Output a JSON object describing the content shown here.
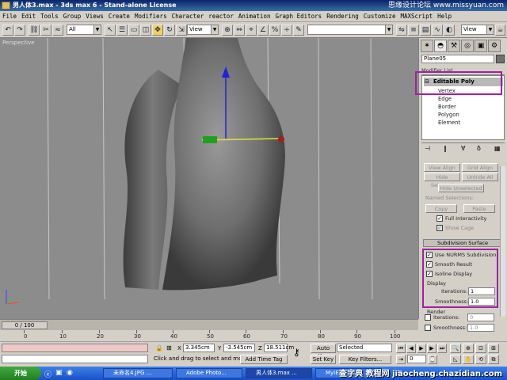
{
  "window": {
    "title": "男人体3.max - 3ds max 6 - Stand-alone License"
  },
  "watermark_top": "思缘设计论坛 www.missyuan.com",
  "menu": [
    "File",
    "Edit",
    "Tools",
    "Group",
    "Views",
    "Create",
    "Modifiers",
    "Character",
    "reactor",
    "Animation",
    "Graph Editors",
    "Rendering",
    "Customize",
    "MAXScript",
    "Help"
  ],
  "toolbar": {
    "selection_filter": "All",
    "ref_coord": "View",
    "named_sel": "",
    "view_dropdown": "View"
  },
  "viewport": {
    "label": "Perspective"
  },
  "panel": {
    "object_name": "Plane05",
    "modifier_list": "Modifier List",
    "stack_top": "Editable Poly",
    "stack_items": [
      "Vertex",
      "Edge",
      "Border",
      "Polygon",
      "Element"
    ],
    "buttons": {
      "view_align": "View Align",
      "grid_align": "Grid Align",
      "hide_selected": "Hide Selected",
      "unhide_all": "Unhide All",
      "hide_unselected": "Hide Unselected",
      "named_selections": "Named Selections:",
      "copy": "Copy",
      "paste": "Paste"
    },
    "full_interactivity": "Full Interactivity",
    "show_cage": "Show Cage",
    "subdivision_header": "Subdivision Surface",
    "use_nurms": "Use NURMS Subdivision",
    "smooth_result": "Smooth Result",
    "isoline_display": "Isoline Display",
    "display_label": "Display",
    "iterations_label": "Iterations:",
    "iterations_value": "1",
    "smoothness_label": "Smoothness:",
    "smoothness_value": "1.0",
    "render_label": "Render",
    "render_iterations_label": "Iterations:",
    "render_iterations_value": "0",
    "render_smoothness_label": "Smoothness:",
    "render_smoothness_value": "1.0"
  },
  "timeline": {
    "frame_display": "0 / 100",
    "ticks": [
      "0",
      "10",
      "20",
      "30",
      "40",
      "50",
      "60",
      "70",
      "80",
      "90",
      "100"
    ]
  },
  "status": {
    "x_label": "X",
    "x_value": "3.345cm",
    "y_label": "Y",
    "y_value": "-3.545cm",
    "z_label": "Z",
    "z_value": "18.511cm",
    "prompt": "Click and drag to select and move",
    "add_time_tag": "Add Time Tag",
    "auto_key": "Auto Key",
    "selected": "Selected",
    "set_key": "Set Key",
    "key_filters": "Key Filters...",
    "frame_field": "0"
  },
  "taskbar": {
    "start": "开始",
    "tasks": [
      "未命名4.JPG ...",
      "Adobe Photo...",
      "男人体3.max ...",
      "MyIE2 - [火..."
    ],
    "tray_text": "与",
    "watermark": "查字典 教程网 jiaocheng.chazidian.com"
  },
  "colors": {
    "highlight": "#a020a0",
    "title_bar": "#0a246a",
    "viewport_bg": "#8c8c8c"
  }
}
